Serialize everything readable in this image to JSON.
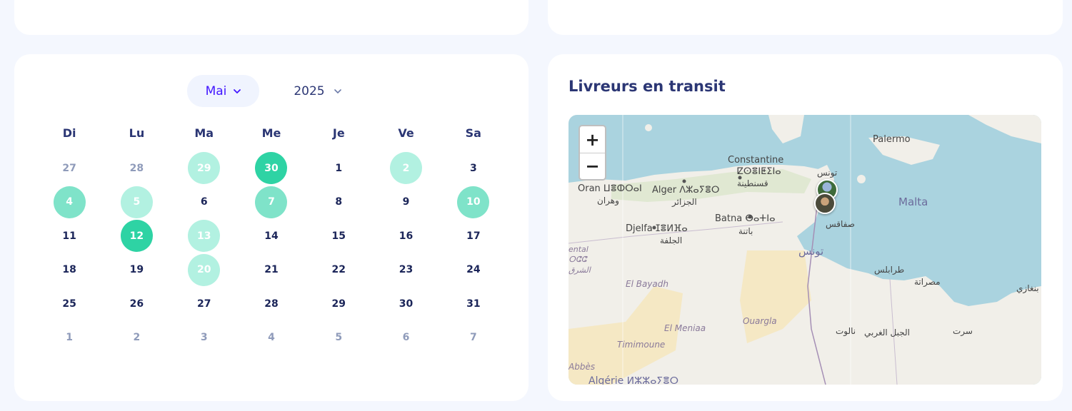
{
  "calendar": {
    "month": "Mai",
    "year": "2025",
    "weekdays": [
      "Di",
      "Lu",
      "Ma",
      "Me",
      "Je",
      "Ve",
      "Sa"
    ],
    "weeks": [
      [
        "27",
        "28",
        "29",
        "30",
        "1",
        "2",
        "3"
      ],
      [
        "4",
        "5",
        "6",
        "7",
        "8",
        "9",
        "10"
      ],
      [
        "11",
        "12",
        "13",
        "14",
        "15",
        "16",
        "17"
      ],
      [
        "18",
        "19",
        "20",
        "21",
        "22",
        "23",
        "24"
      ],
      [
        "25",
        "26",
        "27",
        "28",
        "29",
        "30",
        "31"
      ],
      [
        "1",
        "2",
        "3",
        "4",
        "5",
        "6",
        "7"
      ]
    ],
    "colors": {
      "light": "#b2f1e1",
      "mid": "#7fe3c9",
      "dark": "#2ed3a4",
      "accent": "#4318ff"
    }
  },
  "map_card": {
    "title": "Livreurs en transit",
    "zoom_in": "+",
    "zoom_out": "−",
    "labels": {
      "constantine": "Constantine",
      "constantine_tf": "ⵇⵙⴻⵏⵟⵉⵏⴰ",
      "constantine_ar": "قسنطينة",
      "palermo": "Palermo",
      "oran": "Oran ⵡⴻⵀⵔⴰⵏ",
      "oran_ar": "وهران",
      "alger": "Alger ⴷⵣⴰⵢⴻⵔ",
      "alger_ar": "الجزائر",
      "batna": "Batna ⴱⴰⵜⵏⴰ",
      "batna_ar": "باتنة",
      "djelfa": "Djelfa ⵊⴻⵍⴼⴰ",
      "djelfa_ar": "الجلفة",
      "tunis_ar": "تونس",
      "sfax_ar": "صفاقس",
      "tunisia_ar": "تونس",
      "malta": "Malta",
      "tripoli_ar": "طرابلس",
      "misrata_ar": "مصراتة",
      "benghazi_ar": "بنغازي",
      "sirte_ar": "سرت",
      "nalut_ar": "نالوت",
      "jabal_ar": "الجبل الغربي",
      "el_bayadh": "El Bayadh",
      "el_meniaa": "El Meniaa",
      "ouargla": "Ouargla",
      "timimoune": "Timimoune",
      "abbes": "Abbès",
      "algerie": "Algérie ⵍⵣⵣⴰⵢⴻⵔ",
      "west_1": "ental",
      "west_2": "ⵔⵛⵛ",
      "west_3": "الشرق"
    },
    "colors": {
      "sea": "#aad3df",
      "land": "#f1efe9",
      "desert": "#f5e8c4"
    }
  }
}
